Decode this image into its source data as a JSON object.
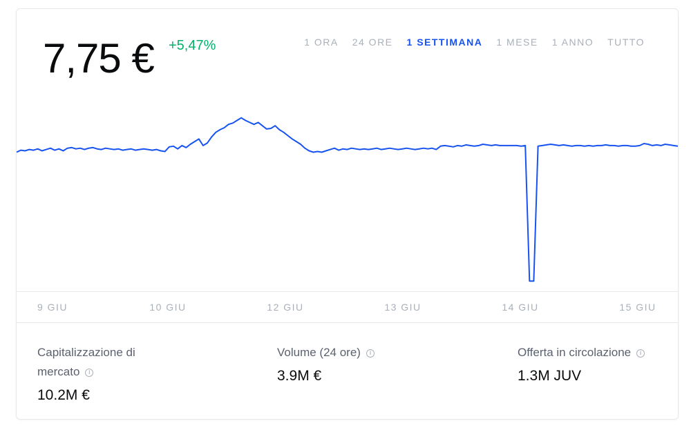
{
  "header": {
    "price": "7,75 €",
    "change": "+5,47%",
    "change_color": "#05b169"
  },
  "ranges": [
    {
      "label": "1 ORA",
      "active": false
    },
    {
      "label": "24 ORE",
      "active": false
    },
    {
      "label": "1 SETTIMANA",
      "active": true
    },
    {
      "label": "1 MESE",
      "active": false
    },
    {
      "label": "1 ANNO",
      "active": false
    },
    {
      "label": "TUTTO",
      "active": false
    }
  ],
  "accent_color": "#1652f0",
  "chart_data": {
    "type": "line",
    "title": "",
    "xlabel": "",
    "ylabel": "",
    "x_tick_labels": [
      "9 GIU",
      "10 GIU",
      "12 GIU",
      "13 GIU",
      "14 GIU",
      "15 GIU"
    ],
    "ylim": [
      5.6,
      8.2
    ],
    "grid": false,
    "line_color": "#1652f0",
    "series": [
      {
        "values": [
          7.6,
          7.63,
          7.62,
          7.64,
          7.63,
          7.65,
          7.62,
          7.64,
          7.66,
          7.63,
          7.65,
          7.62,
          7.66,
          7.67,
          7.65,
          7.66,
          7.64,
          7.66,
          7.67,
          7.65,
          7.64,
          7.66,
          7.65,
          7.64,
          7.65,
          7.63,
          7.64,
          7.65,
          7.63,
          7.64,
          7.65,
          7.64,
          7.63,
          7.64,
          7.62,
          7.61,
          7.68,
          7.69,
          7.65,
          7.7,
          7.67,
          7.72,
          7.76,
          7.8,
          7.7,
          7.74,
          7.83,
          7.9,
          7.94,
          7.97,
          8.02,
          8.04,
          8.08,
          8.12,
          8.08,
          8.05,
          8.02,
          8.05,
          8.0,
          7.95,
          7.96,
          8.0,
          7.94,
          7.9,
          7.85,
          7.8,
          7.76,
          7.72,
          7.66,
          7.62,
          7.6,
          7.61,
          7.6,
          7.62,
          7.64,
          7.66,
          7.63,
          7.65,
          7.64,
          7.66,
          7.65,
          7.64,
          7.65,
          7.64,
          7.65,
          7.66,
          7.64,
          7.65,
          7.66,
          7.65,
          7.64,
          7.65,
          7.66,
          7.65,
          7.64,
          7.65,
          7.66,
          7.65,
          7.66,
          7.64,
          7.69,
          7.7,
          7.69,
          7.68,
          7.7,
          7.69,
          7.71,
          7.7,
          7.69,
          7.7,
          7.72,
          7.71,
          7.7,
          7.71,
          7.7,
          7.7,
          7.7,
          7.7,
          7.7,
          7.69,
          7.7,
          5.65,
          5.65,
          7.69,
          7.7,
          7.71,
          7.72,
          7.71,
          7.7,
          7.71,
          7.7,
          7.69,
          7.7,
          7.7,
          7.69,
          7.7,
          7.69,
          7.7,
          7.7,
          7.71,
          7.7,
          7.7,
          7.69,
          7.7,
          7.7,
          7.69,
          7.69,
          7.7,
          7.73,
          7.72,
          7.7,
          7.71,
          7.7,
          7.72,
          7.71,
          7.7,
          7.69
        ]
      }
    ]
  },
  "stats": {
    "market_cap": {
      "label": "Capitalizzazione di mercato",
      "value": "10.2M  €"
    },
    "volume": {
      "label": "Volume (24 ore)",
      "value": "3.9M  €"
    },
    "supply": {
      "label": "Offerta in circolazione",
      "value": "1.3M JUV"
    }
  },
  "info_icon": "info-icon"
}
